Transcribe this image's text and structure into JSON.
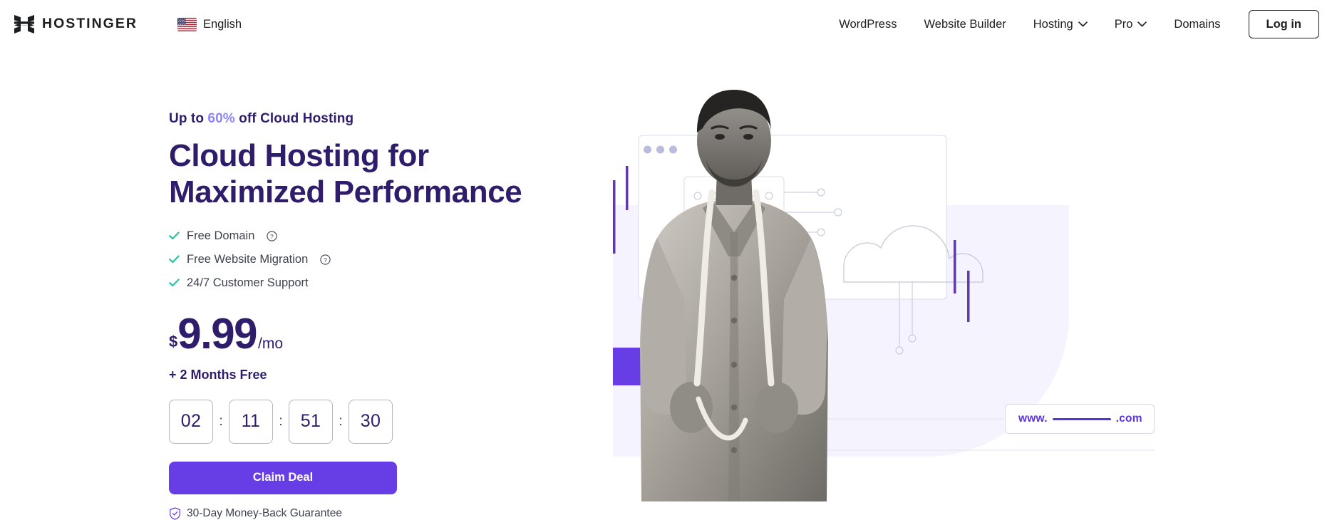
{
  "header": {
    "brand_name": "HOSTINGER",
    "brand_logo_icon": "hostinger-h-logo-icon",
    "language": {
      "label": "English",
      "flag_icon": "us-flag-icon"
    },
    "nav_items": [
      {
        "label": "WordPress",
        "has_dropdown": false
      },
      {
        "label": "Website Builder",
        "has_dropdown": false
      },
      {
        "label": "Hosting",
        "has_dropdown": true
      },
      {
        "label": "Pro",
        "has_dropdown": true
      },
      {
        "label": "Domains",
        "has_dropdown": false
      }
    ],
    "login_label": "Log in"
  },
  "hero": {
    "eyebrow_pre": "Up to ",
    "eyebrow_percent": "60%",
    "eyebrow_post": " off Cloud Hosting",
    "headline_line1": "Cloud Hosting for",
    "headline_line2": "Maximized Performance",
    "features": [
      {
        "label": "Free Domain",
        "has_info": true
      },
      {
        "label": "Free Website Migration",
        "has_info": true
      },
      {
        "label": "24/7 Customer Support",
        "has_info": false
      }
    ],
    "price": {
      "currency": "$",
      "amount": "9.99",
      "period": "/mo"
    },
    "bonus": "+ 2 Months Free",
    "countdown": {
      "days": "02",
      "hours": "11",
      "minutes": "51",
      "seconds": "30",
      "separator": ":"
    },
    "cta_label": "Claim Deal",
    "guarantee": "30-Day Money-Back Guarantee",
    "guarantee_icon": "shield-check-icon"
  },
  "illustration": {
    "domain_prefix": "www.",
    "domain_suffix": ".com",
    "browser_dots": 3,
    "person_alt": "man-with-measuring-tape-photo"
  },
  "colors": {
    "brand_purple": "#673de6",
    "deep_purple": "#2f1c6a",
    "accent_light_purple": "#8c85ff",
    "check_teal": "#2ec4a6",
    "body_text": "#3f4350",
    "lavender_bg": "#f4f3fe",
    "outline_gray": "#d8dae4"
  }
}
